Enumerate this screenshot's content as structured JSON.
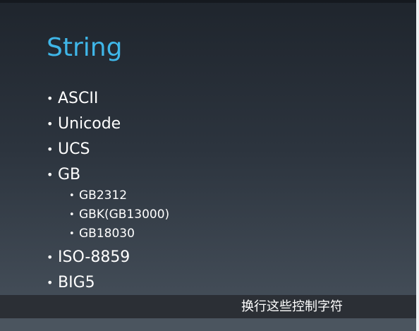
{
  "slide": {
    "title": "String",
    "bullets": [
      {
        "label": "ASCII"
      },
      {
        "label": "Unicode"
      },
      {
        "label": "UCS"
      },
      {
        "label": "GB",
        "children": [
          "GB2312",
          "GBK(GB13000)",
          "GB18030"
        ]
      },
      {
        "label": "ISO-8859"
      },
      {
        "label": "BIG5"
      }
    ]
  },
  "caption": {
    "text": "换行这些控制字符"
  },
  "colors": {
    "title": "#3fb6e8",
    "text": "#ffffff",
    "caption_bar": "#2b2f35"
  }
}
